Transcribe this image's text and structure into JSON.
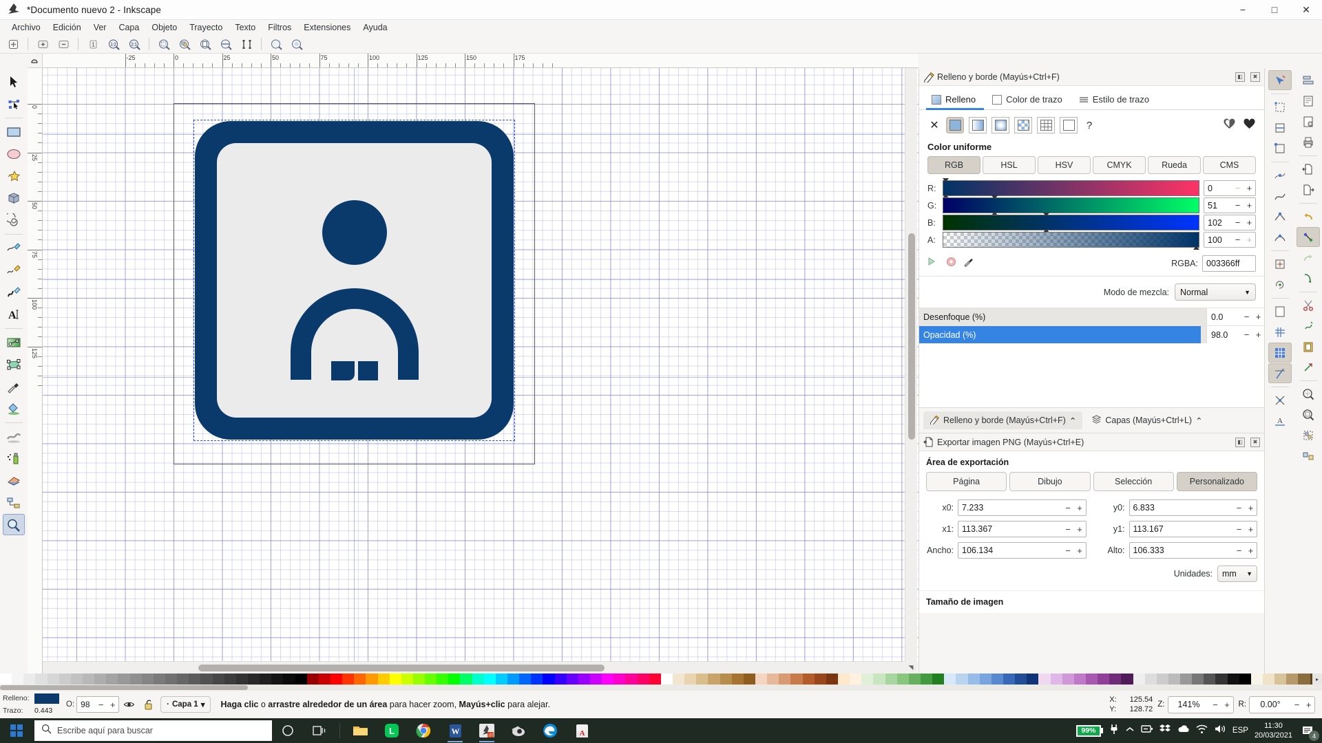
{
  "window": {
    "title": "*Documento nuevo 2 - Inkscape",
    "app_icon": "inkscape-logo-icon",
    "minimize": "−",
    "maximize": "□",
    "close": "✕"
  },
  "menubar": {
    "items": [
      "Archivo",
      "Edición",
      "Ver",
      "Capa",
      "Objeto",
      "Trayecto",
      "Texto",
      "Filtros",
      "Extensiones",
      "Ayuda"
    ]
  },
  "commandbar": {
    "groups": [
      {
        "buttons": [
          {
            "name": "new-document-icon",
            "glyph": "◈"
          }
        ]
      },
      {
        "buttons": [
          {
            "name": "zoom-in-icon",
            "glyph": "⊕"
          },
          {
            "name": "zoom-out-icon",
            "glyph": "⊖"
          }
        ]
      },
      {
        "buttons": [
          {
            "name": "zoom-1-1-icon",
            "glyph": "1"
          },
          {
            "name": "zoom-1-2-icon",
            "glyph": "1:2"
          },
          {
            "name": "zoom-2-1-icon",
            "glyph": "2:1"
          }
        ]
      },
      {
        "buttons": [
          {
            "name": "zoom-selection-icon",
            "glyph": "⌖"
          },
          {
            "name": "zoom-drawing-icon",
            "glyph": "⌗"
          },
          {
            "name": "zoom-page-icon",
            "glyph": "▣"
          },
          {
            "name": "zoom-page-width-icon",
            "glyph": "◐"
          },
          {
            "name": "zoom-center-page-icon",
            "glyph": "⟦⟧"
          }
        ]
      },
      {
        "buttons": [
          {
            "name": "zoom-prev-icon",
            "glyph": "⊙"
          },
          {
            "name": "zoom-next-icon",
            "glyph": "⊚"
          }
        ]
      }
    ]
  },
  "toolbox": {
    "tools": [
      {
        "name": "selector-tool",
        "label": "Selector",
        "active": false
      },
      {
        "name": "node-editor-tool",
        "label": "Editor de nodos",
        "active": false
      },
      {
        "name": "rectangle-tool",
        "label": "Rectángulo",
        "active": false
      },
      {
        "name": "ellipse-tool",
        "label": "Elipse",
        "active": false
      },
      {
        "name": "star-tool",
        "label": "Estrella",
        "active": false
      },
      {
        "name": "box-3d-tool",
        "label": "Caja 3D",
        "active": false
      },
      {
        "name": "spiral-tool",
        "label": "Espiral",
        "active": false
      },
      {
        "name": "pencil-tool",
        "label": "Lápiz",
        "active": false
      },
      {
        "name": "bezier-tool",
        "label": "Bezier",
        "active": false
      },
      {
        "name": "calligraphy-tool",
        "label": "Caligrafía",
        "active": false
      },
      {
        "name": "text-tool",
        "label": "Texto",
        "active": false
      },
      {
        "name": "gradient-tool",
        "label": "Degradado",
        "active": false
      },
      {
        "name": "mesh-gradient-tool",
        "label": "Malla",
        "active": false
      },
      {
        "name": "dropper-tool",
        "label": "Cuentagotas",
        "active": false
      },
      {
        "name": "paint-bucket-tool",
        "label": "Relleno",
        "active": false
      },
      {
        "name": "tweak-tool",
        "label": "Retoque",
        "active": false
      },
      {
        "name": "spray-tool",
        "label": "Pulverizar",
        "active": false
      },
      {
        "name": "eraser-tool",
        "label": "Borrador",
        "active": false
      },
      {
        "name": "connector-tool",
        "label": "Conector",
        "active": false
      },
      {
        "name": "zoom-tool",
        "label": "Ampliación",
        "active": true
      }
    ]
  },
  "rulers": {
    "horizontal_labels": [
      "-25",
      "0",
      "25",
      "50",
      "75",
      "100",
      "125",
      "150",
      "175"
    ],
    "vertical_labels": [
      "0",
      "25",
      "50",
      "75",
      "100",
      "125"
    ],
    "unit_badge": "1"
  },
  "panels": {
    "fill_stroke": {
      "title": "Relleno y borde (Mayús+Ctrl+F)",
      "icon": "fill-stroke-icon",
      "dock_btn": "◧",
      "close_btn": "✖",
      "tabs": [
        {
          "name": "tab-relleno",
          "label": "Relleno",
          "active": true
        },
        {
          "name": "tab-color-trazo",
          "label": "Color de trazo",
          "active": false
        },
        {
          "name": "tab-estilo-trazo",
          "label": "Estilo de trazo",
          "active": false
        }
      ],
      "fill_types": [
        {
          "name": "fill-none",
          "glyph": "✕",
          "selected": false
        },
        {
          "name": "fill-flat-color",
          "glyph": "",
          "selected": true
        },
        {
          "name": "fill-linear-gradient",
          "glyph": "",
          "selected": false
        },
        {
          "name": "fill-radial-gradient",
          "glyph": "",
          "selected": false
        },
        {
          "name": "fill-pattern",
          "glyph": "",
          "selected": false
        },
        {
          "name": "fill-swatch",
          "glyph": "",
          "selected": false
        },
        {
          "name": "fill-mesh-gradient",
          "glyph": "",
          "selected": false
        },
        {
          "name": "fill-unknown",
          "glyph": "?",
          "selected": false
        }
      ],
      "fill_rules": [
        {
          "name": "fill-rule-evenodd",
          "glyph": "◑"
        },
        {
          "name": "fill-rule-nonzero",
          "glyph": "♥",
          "selected": true
        }
      ],
      "uniform_color_label": "Color uniforme",
      "color_modes": [
        {
          "name": "mode-rgb",
          "label": "RGB",
          "selected": true
        },
        {
          "name": "mode-hsl",
          "label": "HSL",
          "selected": false
        },
        {
          "name": "mode-hsv",
          "label": "HSV",
          "selected": false
        },
        {
          "name": "mode-cmyk",
          "label": "CMYK",
          "selected": false
        },
        {
          "name": "mode-rueda",
          "label": "Rueda",
          "selected": false
        },
        {
          "name": "mode-cms",
          "label": "CMS",
          "selected": false
        }
      ],
      "channels": [
        {
          "name": "channel-r",
          "label": "R:",
          "value": "0",
          "pos_pct": 0
        },
        {
          "name": "channel-g",
          "label": "G:",
          "value": "51",
          "pos_pct": 20
        },
        {
          "name": "channel-b",
          "label": "B:",
          "value": "102",
          "pos_pct": 40
        },
        {
          "name": "channel-a",
          "label": "A:",
          "value": "100",
          "pos_pct": 100
        }
      ],
      "rgba_label": "RGBA:",
      "rgba_value": "003366ff",
      "blend_label": "Modo de mezcla:",
      "blend_value": "Normal",
      "blur_label": "Desenfoque (%)",
      "blur_value": "0.0",
      "opacity_label": "Opacidad (%)",
      "opacity_value": "98.0",
      "opacity_pct": 98
    },
    "dock_tabs": [
      {
        "name": "dock-tab-fill-stroke",
        "label": "Relleno y borde (Mayús+Ctrl+F)",
        "icon": "fill-stroke-icon",
        "chevron": "⌃",
        "active": true
      },
      {
        "name": "dock-tab-layers",
        "label": "Capas (Mayús+Ctrl+L)",
        "icon": "layers-icon",
        "chevron": "⌃",
        "active": false
      }
    ],
    "export": {
      "title": "Exportar imagen PNG (Mayús+Ctrl+E)",
      "icon": "export-png-icon",
      "dock_btn": "◧",
      "close_btn": "✖",
      "area_label": "Área de exportación",
      "area_buttons": [
        {
          "name": "export-area-pagina",
          "label": "Página",
          "selected": false
        },
        {
          "name": "export-area-dibujo",
          "label": "Dibujo",
          "selected": false
        },
        {
          "name": "export-area-seleccion",
          "label": "Selección",
          "selected": false
        },
        {
          "name": "export-area-personalizado",
          "label": "Personalizado",
          "selected": true
        }
      ],
      "fields": [
        {
          "name": "export-x0",
          "label": "x0:",
          "value": "7.233"
        },
        {
          "name": "export-y0",
          "label": "y0:",
          "value": "6.833"
        },
        {
          "name": "export-x1",
          "label": "x1:",
          "value": "113.367"
        },
        {
          "name": "export-y1",
          "label": "y1:",
          "value": "113.167"
        },
        {
          "name": "export-ancho",
          "label": "Ancho:",
          "value": "106.134"
        },
        {
          "name": "export-alto",
          "label": "Alto:",
          "value": "106.333"
        }
      ],
      "units_label": "Unidades:",
      "units_value": "mm",
      "image_size_label": "Tamaño de imagen"
    }
  },
  "statusbar": {
    "fill_label": "Relleno:",
    "stroke_label": "Trazo:",
    "fill_color": "#0a3a6b",
    "stroke_value": "0.443",
    "opacity_label": "O:",
    "opacity_value": "98",
    "visibility_icon": "eye-icon",
    "lock_icon": "unlock-icon",
    "layer_name": "Capa 1",
    "layer_caret": "▾",
    "message_a": "Haga clic",
    "message_b": "o",
    "message_c": "arrastre alrededor de un área",
    "message_d": "para hacer zoom,",
    "message_e": "Mayús+clic",
    "message_f": "para alejar.",
    "x_label": "X:",
    "x_value": "125.54",
    "y_label": "Y:",
    "y_value": "128.72",
    "zoom_label": "Z:",
    "zoom_value": "141%",
    "rotate_label": "R:",
    "rotate_value": "0.00°"
  },
  "taskbar": {
    "start_icon": "windows-start-icon",
    "search_placeholder": "Escribe aquí para buscar",
    "search_icon": "search-icon",
    "apps": [
      {
        "name": "taskview-cortana-icon",
        "glyph": "○",
        "running": false
      },
      {
        "name": "taskview-icon",
        "glyph": "⊞",
        "running": false
      },
      {
        "name": "file-explorer-icon",
        "glyph": "",
        "running": false
      },
      {
        "name": "line-app-icon",
        "glyph": "L",
        "running": false
      },
      {
        "name": "chrome-icon",
        "glyph": "",
        "running": false
      },
      {
        "name": "word-icon",
        "glyph": "W",
        "running": true
      },
      {
        "name": "inkscape-icon",
        "glyph": "",
        "running": true
      },
      {
        "name": "blender-icon",
        "glyph": "",
        "running": false
      },
      {
        "name": "edge-icon",
        "glyph": "",
        "running": false
      },
      {
        "name": "acrobat-reader-icon",
        "glyph": "",
        "running": false
      }
    ],
    "battery_pct": "99%",
    "tray_icons": [
      "plug-icon",
      "chevron-up-icon",
      "battery-saver-icon",
      "dropbox-icon",
      "onedrive-icon",
      "wifi-icon",
      "volume-icon"
    ],
    "language": "ESP",
    "time": "11:30",
    "date": "20/03/2021",
    "notification_count": "4",
    "notification_icon": "notification-icon"
  }
}
